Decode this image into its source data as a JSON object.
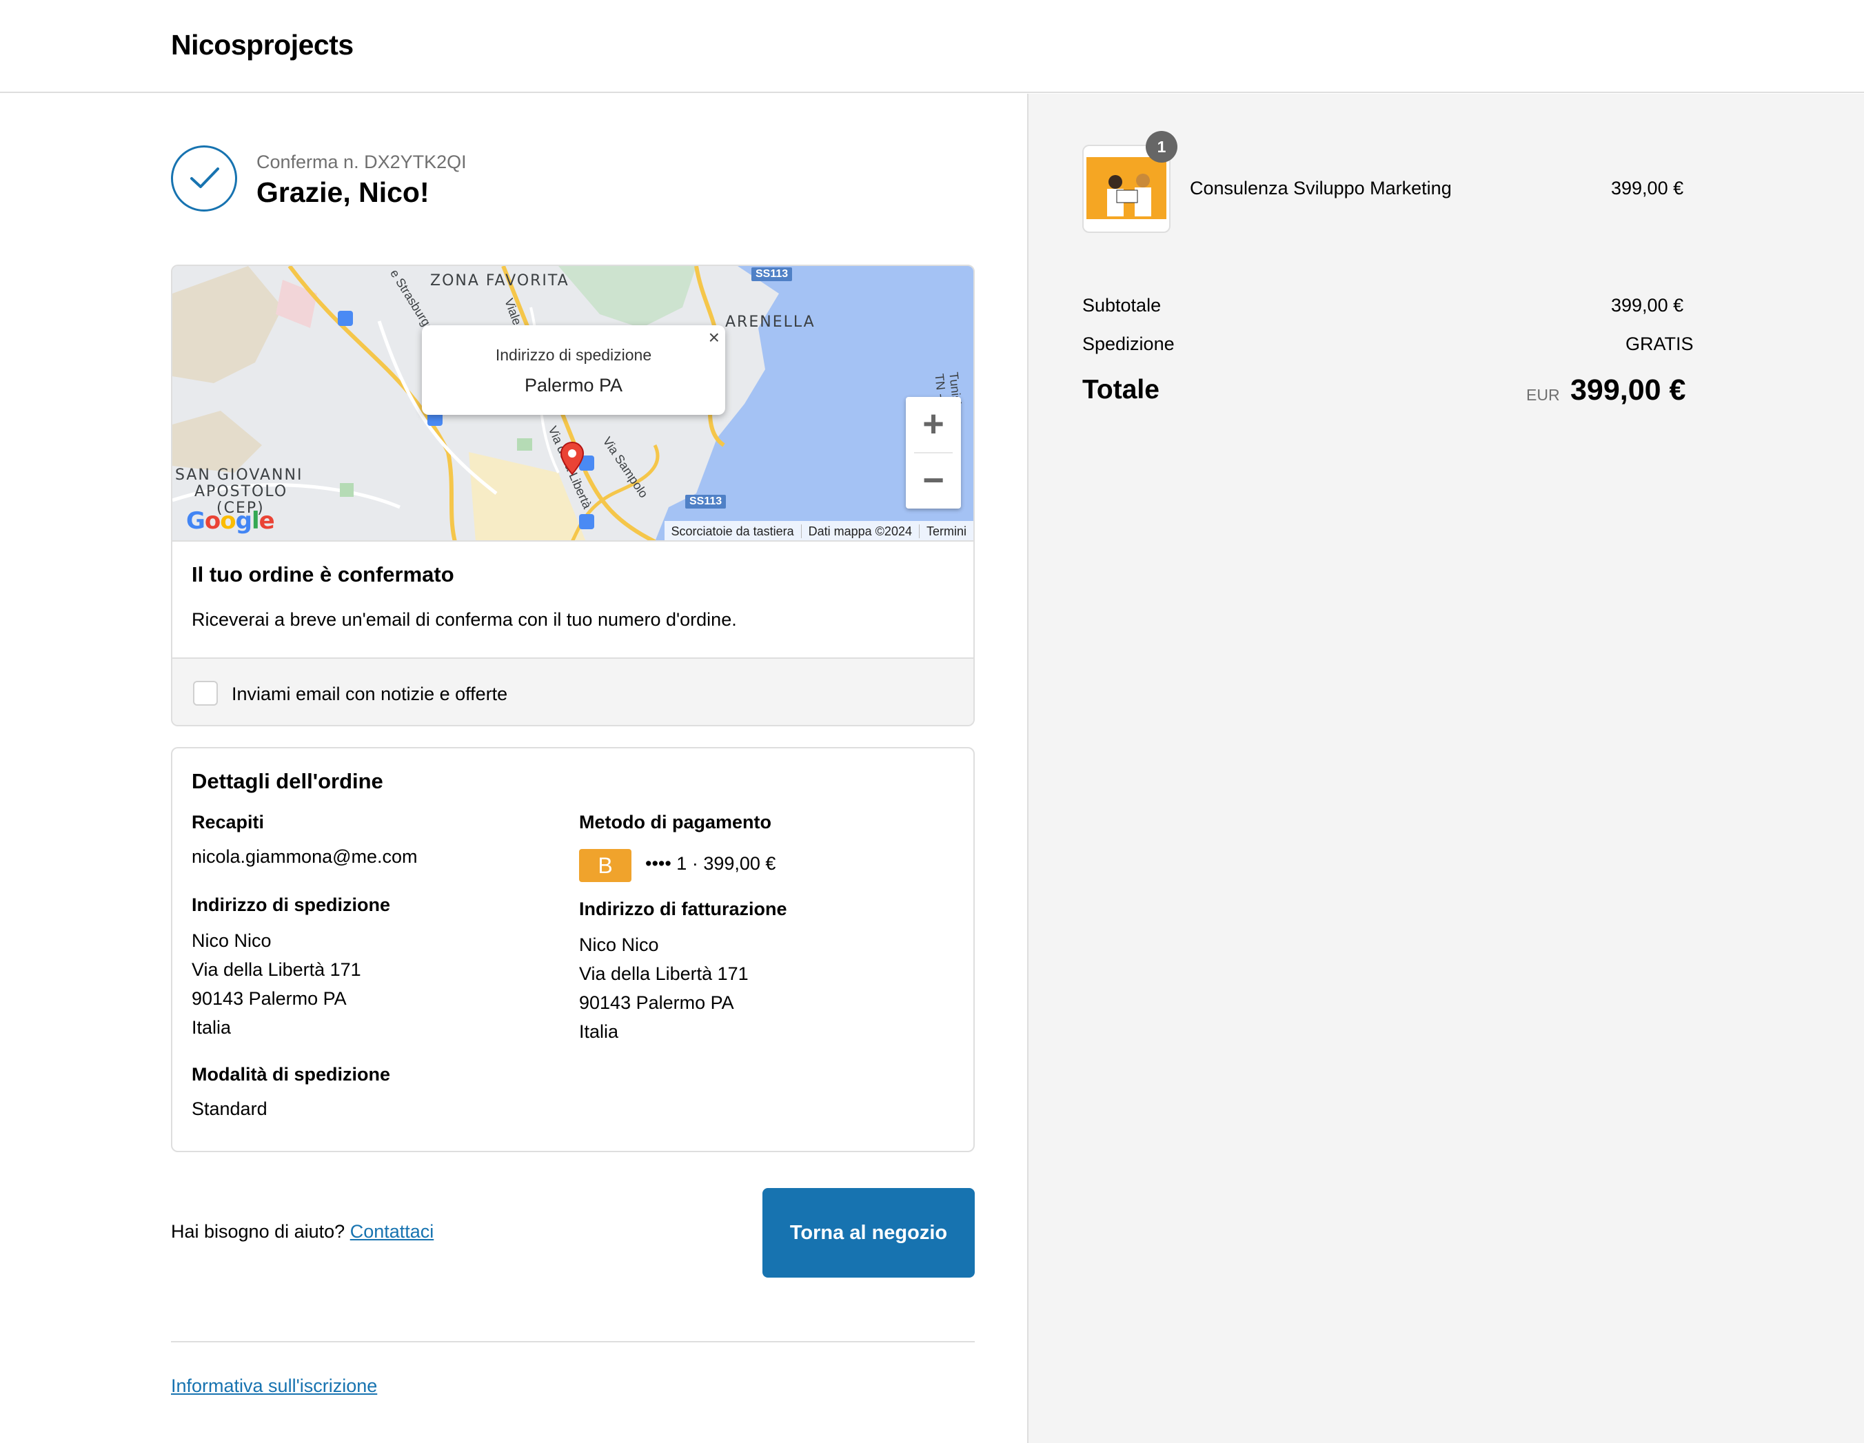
{
  "header": {
    "brand": "Nicosprojects"
  },
  "confirmation": {
    "number_label": "Conferma n. DX2YTK2QI",
    "greeting": "Grazie, Nico!"
  },
  "map": {
    "labels": {
      "zona_favorita": "ZONA FAVORITA",
      "arenella": "ARENELLA",
      "san_giovanni": "SAN GIOVANNI",
      "apostolo": "APOSTOLO",
      "cep": "(CEP)",
      "ss113_top": "SS113",
      "ss113_bottom": "SS113",
      "strasburgo": "e Strasburgo",
      "viale": "Viale",
      "via_liberta": "Via della Libertà",
      "via_sampolo": "Via Sampolo",
      "tunisi": "Tunisi - TN - Pal"
    },
    "popup": {
      "title": "Indirizzo di spedizione",
      "city": "Palermo PA"
    },
    "zoom_in": "+",
    "zoom_out": "−",
    "logo": "Google",
    "attribution": [
      "Scorciatoie da tastiera",
      "Dati mappa ©2024",
      "Termini"
    ]
  },
  "order_confirmed": {
    "title": "Il tuo ordine è confermato",
    "text": "Riceverai a breve un'email di conferma con il tuo numero d'ordine.",
    "optin_label": "Inviami email con notizie e offerte"
  },
  "details": {
    "title": "Dettagli dell'ordine",
    "contact_heading": "Recapiti",
    "email": "nicola.giammona@me.com",
    "shipping_heading": "Indirizzo di spedizione",
    "shipping_address": [
      "Nico Nico",
      "Via della Libertà 171",
      "90143 Palermo PA",
      "Italia"
    ],
    "shipping_method_heading": "Modalità di spedizione",
    "shipping_method": "Standard",
    "payment_heading": "Metodo di pagamento",
    "payment_badge": "B",
    "payment_text": "•••• 1 · 399,00 €",
    "billing_heading": "Indirizzo di fatturazione",
    "billing_address": [
      "Nico Nico",
      "Via della Libertà 171",
      "90143 Palermo PA",
      "Italia"
    ]
  },
  "footer": {
    "help_text": "Hai bisogno di aiuto?",
    "contact_link": "Contattaci",
    "return_button": "Torna al negozio",
    "policy_link": "Informativa sull'iscrizione"
  },
  "summary": {
    "item_qty": "1",
    "item_name": "Consulenza Sviluppo Marketing",
    "item_price": "399,00 €",
    "subtotal_label": "Subtotale",
    "subtotal_value": "399,00 €",
    "shipping_label": "Spedizione",
    "shipping_value": "GRATIS",
    "total_label": "Totale",
    "currency": "EUR",
    "total_value": "399,00 €"
  },
  "colors": {
    "accent": "#1773b0",
    "panel_bg": "#f4f4f4",
    "payment_badge": "#f0a32c"
  }
}
